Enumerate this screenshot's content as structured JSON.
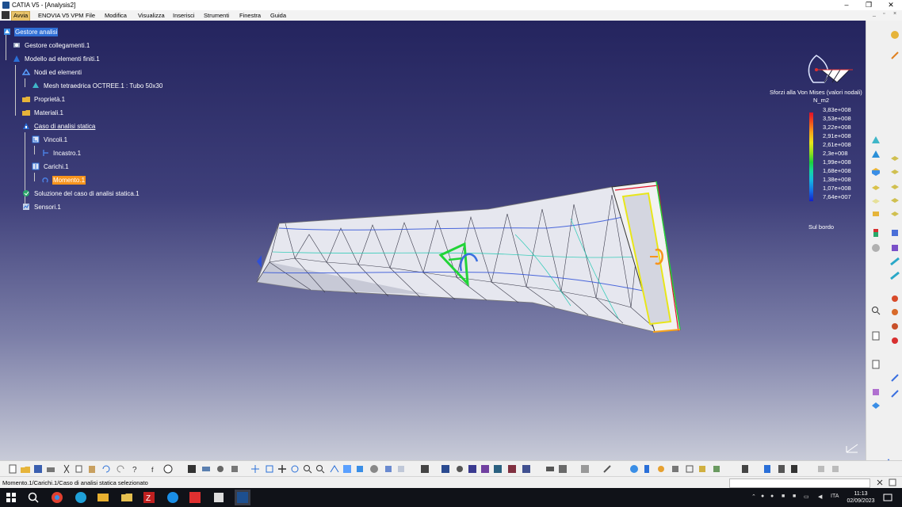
{
  "window": {
    "title": "CATIA V5 - [Analysis2]",
    "minimize": "–",
    "maximize": "❐",
    "close": "✕"
  },
  "menu": {
    "items": [
      "Avvia",
      "ENOVIA V5 VPM",
      "File",
      "Modifica",
      "Visualizza",
      "Inserisci",
      "Strumenti",
      "Finestra",
      "Guida"
    ],
    "active": "Avvia",
    "doc_controls": [
      "_",
      "▫",
      "×"
    ]
  },
  "tree": {
    "nodes": [
      {
        "label": "Gestore analisi",
        "state": "selected"
      },
      {
        "label": "Gestore collegamenti.1",
        "state": ""
      },
      {
        "label": "Modello ad elementi finiti.1",
        "state": ""
      },
      {
        "label": "Nodi ed elementi",
        "state": ""
      },
      {
        "label": "Mesh tetraedrica OCTREE.1 : Tubo 50x30",
        "state": ""
      },
      {
        "label": "Proprietà.1",
        "state": ""
      },
      {
        "label": "Materiali.1",
        "state": ""
      },
      {
        "label": "Caso di analisi statica",
        "state": "underlined"
      },
      {
        "label": "Vincoli.1",
        "state": ""
      },
      {
        "label": "Incastro.1",
        "state": ""
      },
      {
        "label": "Carichi.1",
        "state": ""
      },
      {
        "label": "Momento.1",
        "state": "highlighted"
      },
      {
        "label": "Soluzione del caso di analisi statica.1",
        "state": ""
      },
      {
        "label": "Sensori.1",
        "state": ""
      }
    ]
  },
  "legend": {
    "title": "Sforzi alla Von Mises (valori nodali)",
    "unit": "N_m2",
    "values": [
      "3,83e+008",
      "3,53e+008",
      "3,22e+008",
      "2,91e+008",
      "2,61e+008",
      "2,3e+008",
      "1,99e+008",
      "1,68e+008",
      "1,38e+008",
      "1,07e+008",
      "7,64e+007"
    ],
    "footer": "Sul bordo",
    "colors": [
      "#e0102a",
      "#f7a21a",
      "#e8e61a",
      "#1dd23a",
      "#14b8e0",
      "#1420c8"
    ]
  },
  "status": {
    "message": "Momento.1/Carichi.1/Caso di analisi statica selezionato"
  },
  "taskbar": {
    "apps": [
      "start-icon",
      "search-icon",
      "chrome-icon",
      "edge-icon",
      "mail-icon",
      "folder-icon",
      "filezilla-icon",
      "teamviewer-icon",
      "anydesk-icon",
      "files-icon",
      "catia-icon"
    ],
    "language": "ITA",
    "time": "11:13",
    "date": "02/09/2023"
  }
}
